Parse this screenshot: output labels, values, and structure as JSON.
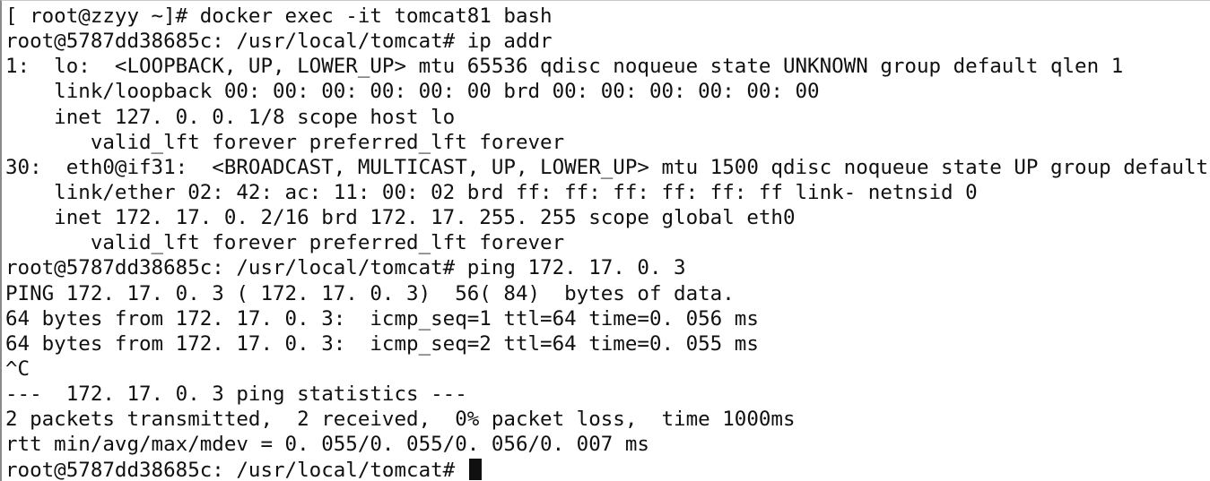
{
  "terminal": {
    "lines": [
      "[ root@zzyy ~]# docker exec -it tomcat81 bash",
      "root@5787dd38685c: /usr/local/tomcat# ip addr",
      "1:  lo:  <LOOPBACK, UP, LOWER_UP> mtu 65536 qdisc noqueue state UNKNOWN group default qlen 1",
      "    link/loopback 00: 00: 00: 00: 00: 00 brd 00: 00: 00: 00: 00: 00",
      "    inet 127. 0. 0. 1/8 scope host lo",
      "       valid_lft forever preferred_lft forever",
      "30:  eth0@if31:  <BROADCAST, MULTICAST, UP, LOWER_UP> mtu 1500 qdisc noqueue state UP group default",
      "    link/ether 02: 42: ac: 11: 00: 02 brd ff: ff: ff: ff: ff: ff link- netnsid 0",
      "    inet 172. 17. 0. 2/16 brd 172. 17. 255. 255 scope global eth0",
      "       valid_lft forever preferred_lft forever",
      "root@5787dd38685c: /usr/local/tomcat# ping 172. 17. 0. 3",
      "PING 172. 17. 0. 3 ( 172. 17. 0. 3)  56( 84)  bytes of data.",
      "64 bytes from 172. 17. 0. 3:  icmp_seq=1 ttl=64 time=0. 056 ms",
      "64 bytes from 172. 17. 0. 3:  icmp_seq=2 ttl=64 time=0. 055 ms",
      "^C",
      "---  172. 17. 0. 3 ping statistics ---",
      "2 packets transmitted,  2 received,  0% packet loss,  time 1000ms",
      "rtt min/avg/max/mdev = 0. 055/0. 055/0. 056/0. 007 ms"
    ],
    "prompt": "root@5787dd38685c: /usr/local/tomcat# "
  }
}
